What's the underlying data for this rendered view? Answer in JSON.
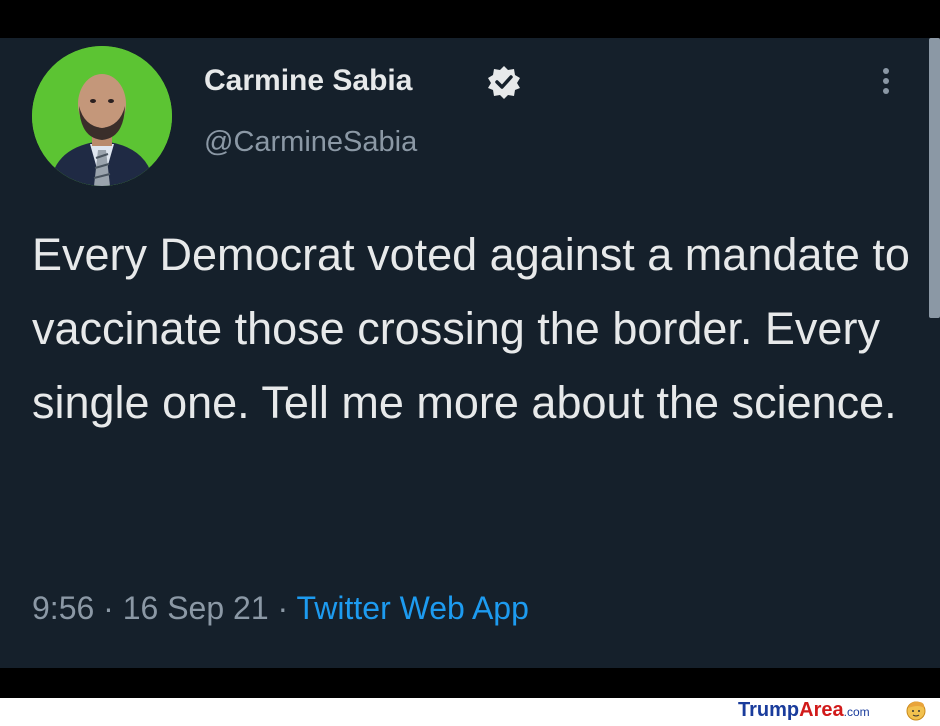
{
  "tweet": {
    "author_name": "Carmine Sabia",
    "handle": "@CarmineSabia",
    "verified": true,
    "text": "Every Democrat voted against a mandate to vaccinate those crossing the border. Every single one. Tell me more about the science.",
    "time": "9:56",
    "separator": "·",
    "date": "16 Sep 21",
    "source": "Twitter Web App"
  },
  "watermark": {
    "brand_first": "Trump",
    "brand_second": "Area",
    "brand_suffix": ".com"
  },
  "icons": {
    "verified": "verified-badge-icon",
    "more": "more-vertical-icon",
    "watermark_face": "trump-face-icon"
  },
  "colors": {
    "background": "#15202b",
    "text": "#e7e9ea",
    "secondary_text": "#8b98a5",
    "link": "#1d9bf0",
    "avatar_background": "#5cc433"
  }
}
